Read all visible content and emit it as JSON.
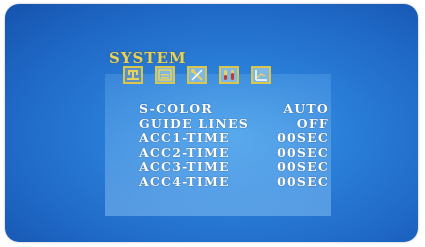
{
  "menu": {
    "title": "SYSTEM",
    "icons": [
      {
        "name": "system-icon",
        "selected": true
      },
      {
        "name": "picture-icon",
        "selected": false
      },
      {
        "name": "tools-icon",
        "selected": false
      },
      {
        "name": "test-tubes-icon",
        "selected": false
      },
      {
        "name": "chart-icon",
        "selected": false
      }
    ]
  },
  "settings": [
    {
      "label": "S-COLOR",
      "value": "AUTO"
    },
    {
      "label": "GUIDE LINES",
      "value": "OFF"
    },
    {
      "label": "ACC1-TIME",
      "value": "00SEC"
    },
    {
      "label": "ACC2-TIME",
      "value": "00SEC"
    },
    {
      "label": "ACC3-TIME",
      "value": "00SEC"
    },
    {
      "label": "ACC4-TIME",
      "value": "00SEC"
    }
  ],
  "colors": {
    "title": "#e9d25a",
    "icon_border": "#d9c64a",
    "background": "#2a7fd8",
    "text": "#ffffff"
  }
}
